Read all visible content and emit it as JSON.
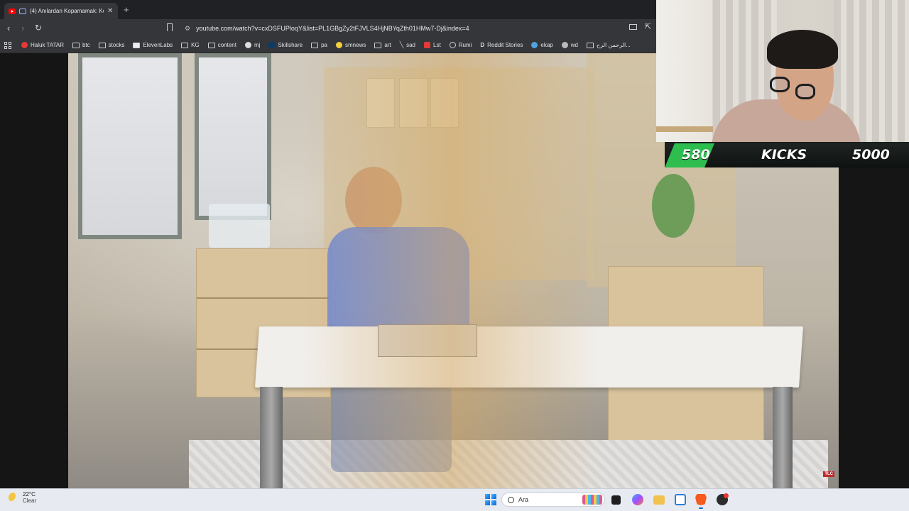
{
  "browser": {
    "tab_title": "(4) Anılardan Kopamamak: Ko",
    "url": "youtube.com/watch?v=cxDSFUPloqY&list=PL1GBgZy2tFJVLS4HjNBYqZth01HMw7-Dj&index=4",
    "bookmarks": [
      {
        "label": "Haluk TATAR",
        "icon": "youtube-icon"
      },
      {
        "label": "btc",
        "icon": "folder-icon"
      },
      {
        "label": "stocks",
        "icon": "folder-icon"
      },
      {
        "label": "ElevenLabs",
        "icon": "elevenlabs-icon"
      },
      {
        "label": "KG",
        "icon": "folder-icon"
      },
      {
        "label": "content",
        "icon": "folder-icon"
      },
      {
        "label": "mj",
        "icon": "github-icon"
      },
      {
        "label": "Skillshare",
        "icon": "skillshare-icon"
      },
      {
        "label": "pa",
        "icon": "folder-icon"
      },
      {
        "label": "smnews",
        "icon": "smiley-icon"
      },
      {
        "label": "art",
        "icon": "folder-icon"
      },
      {
        "label": "sad",
        "icon": "slash-icon"
      },
      {
        "label": "Lst",
        "icon": "s-logo-icon"
      },
      {
        "label": "Rumi",
        "icon": "globe-icon"
      },
      {
        "label": "Reddit Stories",
        "icon": "d-logo-icon"
      },
      {
        "label": "ekap",
        "icon": "bird-icon"
      },
      {
        "label": "wd",
        "icon": "globe-icon"
      },
      {
        "label": "الرحمن الرح...",
        "icon": "book-icon"
      }
    ]
  },
  "kicks": {
    "current": "580",
    "label": "KICKS",
    "goal": "5000"
  },
  "video": {
    "channel_badge": "TLC"
  },
  "taskbar": {
    "temperature": "22°C",
    "condition": "Clear",
    "search_placeholder": "Ara"
  }
}
